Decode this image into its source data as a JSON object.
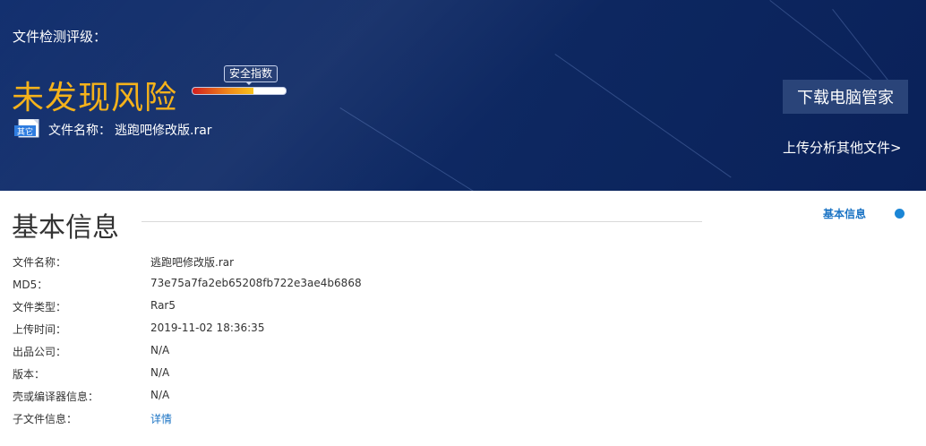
{
  "banner": {
    "detect_label": "文件检测评级：",
    "risk_level": "未发现风险",
    "safety_index_label": "安全指数",
    "safety_index_fraction": 0.65,
    "file_icon_text": "其它",
    "file_name_label": "文件名称：",
    "file_name": "逃跑吧修改版.rar",
    "download_button": "下载电脑管家",
    "upload_link": "上传分析其他文件>"
  },
  "section": {
    "title": "基本信息",
    "side_nav_label": "基本信息"
  },
  "info_rows": [
    {
      "key": "文件名称：",
      "value": "逃跑吧修改版.rar"
    },
    {
      "key": "MD5：",
      "value": "73e75a7fa2eb65208fb722e3ae4b6868"
    },
    {
      "key": "文件类型：",
      "value": "Rar5"
    },
    {
      "key": "上传时间：",
      "value": "2019-11-02 18:36:35"
    },
    {
      "key": "出品公司：",
      "value": "N/A"
    },
    {
      "key": "版本：",
      "value": "N/A"
    },
    {
      "key": "壳或编译器信息：",
      "value": "N/A"
    },
    {
      "key": "子文件信息：",
      "value": "详情"
    }
  ],
  "colors": {
    "risk": "#f5b21b",
    "link": "#1a73c4",
    "banner_bg": "#0f2a66"
  }
}
